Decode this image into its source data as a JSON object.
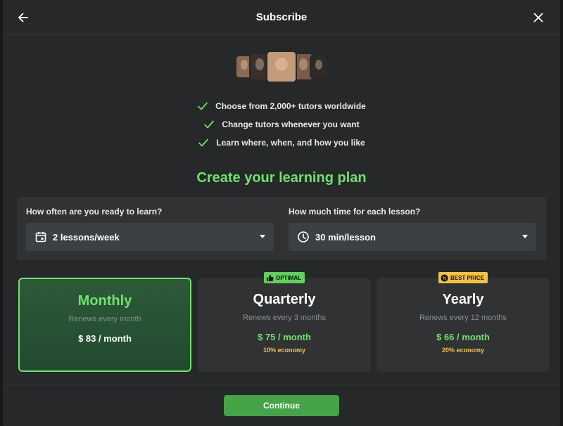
{
  "header": {
    "title": "Subscribe",
    "back_icon": "arrow-left-icon",
    "close_icon": "close-icon"
  },
  "tutors": [
    {
      "color": "#8a6a52",
      "w": 26,
      "h": 34
    },
    {
      "color": "#3a2f2a",
      "w": 30,
      "h": 40
    },
    {
      "color": "#c49a78",
      "w": 44,
      "h": 46
    },
    {
      "color": "#7a5a48",
      "w": 30,
      "h": 40
    },
    {
      "color": "#2e2a28",
      "w": 26,
      "h": 34
    }
  ],
  "features": [
    "Choose from 2,000+ tutors worldwide",
    "Change tutors whenever you want",
    "Learn where, when, and how you like"
  ],
  "plan_title": "Create your learning plan",
  "frequency": {
    "label": "How often are you ready to learn?",
    "value": "2 lessons/week",
    "icon": "calendar-icon"
  },
  "duration": {
    "label": "How much time for each lesson?",
    "value": "30 min/lesson",
    "icon": "clock-icon"
  },
  "plans": [
    {
      "name": "Monthly",
      "renew": "Renews every month",
      "price": "$ 83 / month",
      "economy": "",
      "badge": "",
      "selected": true
    },
    {
      "name": "Quarterly",
      "renew": "Renews every 3 months",
      "price": "$ 75 / month",
      "economy": "10% economy",
      "badge": "OPTIMAL",
      "selected": false
    },
    {
      "name": "Yearly",
      "renew": "Renews every 12 months",
      "price": "$ 66 / month",
      "economy": "20% economy",
      "badge": "BEST PRICE",
      "selected": false
    }
  ],
  "colors": {
    "accent": "#6ee36a",
    "button": "#44a447",
    "economy": "#f0c64a",
    "background": "#26282a"
  },
  "footer": {
    "continue_label": "Continue"
  }
}
